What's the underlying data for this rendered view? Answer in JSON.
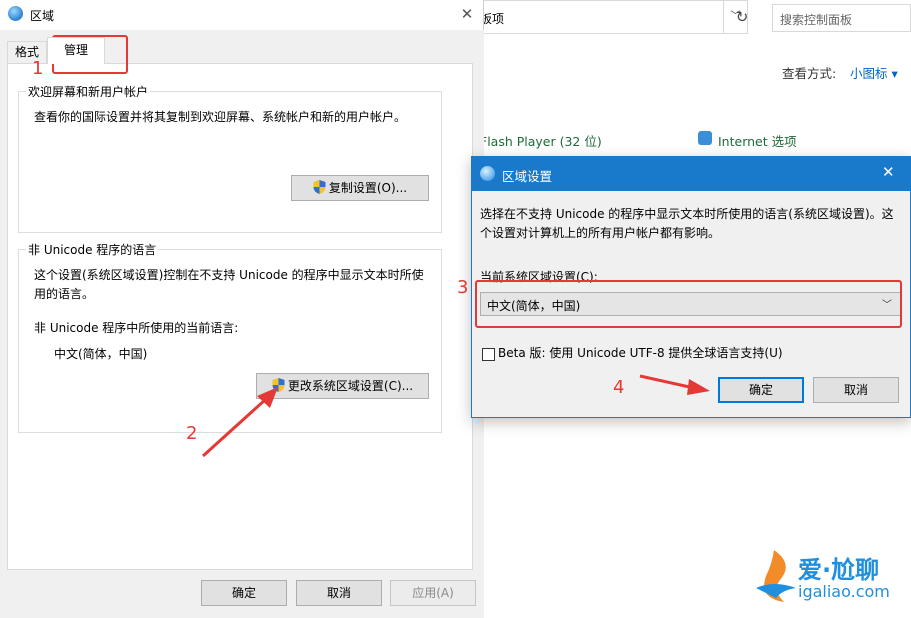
{
  "control_panel": {
    "address_text": "板项",
    "search_placeholder": "搜索控制面板",
    "view_label": "查看方式:",
    "view_value": "小图标 ▾",
    "items": [
      "Flash Player (32 位)",
      "Internet 选项"
    ]
  },
  "region_dialog": {
    "title": "区域",
    "close": "✕",
    "tabs": [
      "格式",
      "管理"
    ],
    "welcome_group": {
      "title": "欢迎屏幕和新用户帐户",
      "description": "查看你的国际设置并将其复制到欢迎屏幕、系统帐户和新的用户帐户。",
      "button": "复制设置(O)..."
    },
    "unicode_group": {
      "title": "非 Unicode 程序的语言",
      "description": "这个设置(系统区域设置)控制在不支持 Unicode 的程序中显示文本时所使用的语言。",
      "current_label": "非 Unicode 程序中所使用的当前语言:",
      "current_value": "中文(简体，中国)",
      "button": "更改系统区域设置(C)..."
    },
    "footer": {
      "ok": "确定",
      "cancel": "取消",
      "apply": "应用(A)"
    }
  },
  "region_settings_dialog": {
    "title": "区域设置",
    "close": "✕",
    "description": "选择在不支持 Unicode 的程序中显示文本时所使用的语言(系统区域设置)。这个设置对计算机上的所有用户帐户都有影响。",
    "locale_label": "当前系统区域设置(C):",
    "locale_value": "中文(简体，中国)",
    "beta_label": "Beta 版: 使用 Unicode UTF-8 提供全球语言支持(U)",
    "beta_checked": false,
    "ok": "确定",
    "cancel": "取消"
  },
  "annotations": [
    "1",
    "2",
    "3",
    "4"
  ],
  "watermark": {
    "cn": "爱·尬聊",
    "url": "igaliao.com"
  },
  "colors": {
    "accent": "#1979ca",
    "annotation": "#e53935"
  }
}
